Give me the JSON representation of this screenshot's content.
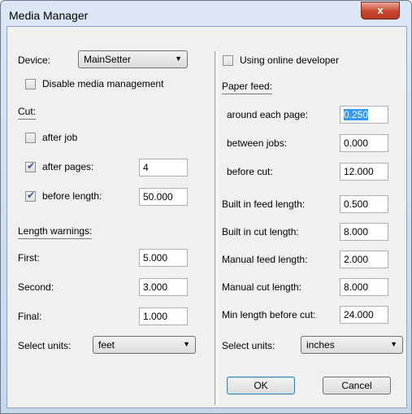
{
  "window": {
    "title": "Media Manager",
    "close_glyph": "x"
  },
  "left": {
    "device_label": "Device:",
    "device_value": "MainSetter",
    "disable_media_label": "Disable media management",
    "disable_media_checked": false,
    "cut_heading": "Cut:",
    "after_job_label": "after job",
    "after_job_checked": false,
    "after_pages_label": "after pages:",
    "after_pages_checked": true,
    "after_pages_value": "4",
    "before_length_label": "before length:",
    "before_length_checked": true,
    "before_length_value": "50.000",
    "warnings_heading": "Length warnings:",
    "first_label": "First:",
    "first_value": "5.000",
    "second_label": "Second:",
    "second_value": "3.000",
    "final_label": "Final:",
    "final_value": "1.000",
    "units_label": "Select units:",
    "units_value": "feet"
  },
  "right": {
    "online_dev_label": "Using online developer",
    "online_dev_checked": false,
    "paper_feed_heading": "Paper feed:",
    "around_label": "around each page:",
    "around_value": "0.250",
    "between_label": "between jobs:",
    "between_value": "0.000",
    "before_cut_label": "before cut:",
    "before_cut_value": "12.000",
    "builtin_feed_label": "Built in feed length:",
    "builtin_feed_value": "0.500",
    "builtin_cut_label": "Built in cut length:",
    "builtin_cut_value": "8.000",
    "manual_feed_label": "Manual feed length:",
    "manual_feed_value": "2.000",
    "manual_cut_label": "Manual cut length:",
    "manual_cut_value": "8.000",
    "min_length_label": "Min length before cut:",
    "min_length_value": "24.000",
    "units_label": "Select units:",
    "units_value": "inches"
  },
  "buttons": {
    "ok": "OK",
    "cancel": "Cancel"
  },
  "icons": {
    "dropdown": "chevron-down-icon",
    "checkmark": "checkmark-icon"
  }
}
